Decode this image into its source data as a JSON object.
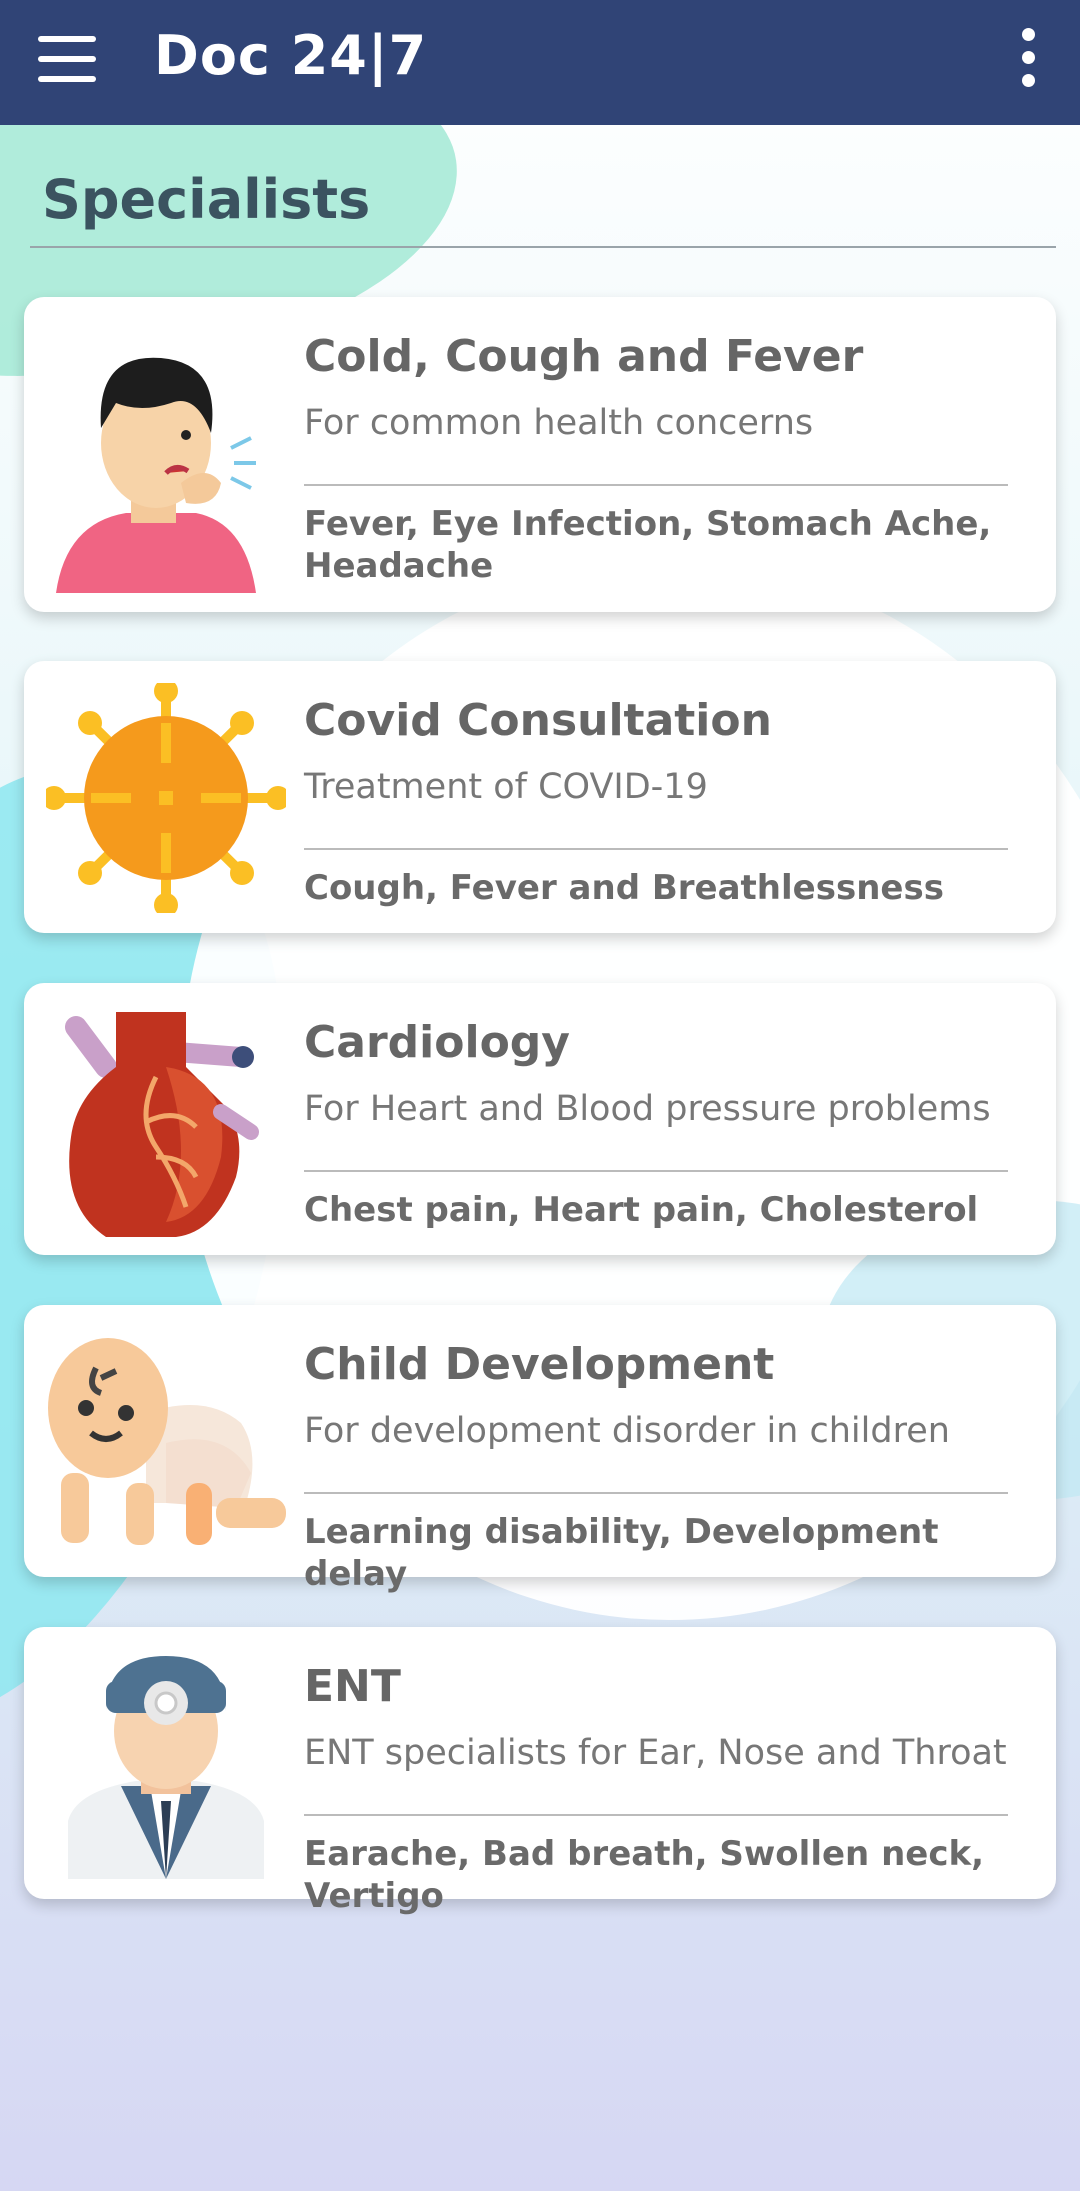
{
  "app": {
    "title": "Doc 24|7",
    "menu_icon": "hamburger-menu-icon",
    "more_icon": "more-vertical-icon",
    "bar_color": "#304476"
  },
  "section": {
    "title": "Specialists"
  },
  "specialists": [
    {
      "title": "Cold, Cough and Fever",
      "subtitle": "For common health concerns",
      "tags": "Fever, Eye Infection, Stomach Ache, Headache",
      "icon": "coughing-person-icon"
    },
    {
      "title": "Covid Consultation",
      "subtitle": "Treatment of COVID-19",
      "tags": "Cough, Fever and Breathlessness",
      "icon": "virus-icon"
    },
    {
      "title": "Cardiology",
      "subtitle": "For Heart and Blood pressure problems",
      "tags": "Chest pain, Heart pain, Cholesterol",
      "icon": "heart-icon"
    },
    {
      "title": "Child Development",
      "subtitle": "For development disorder in children",
      "tags": "Learning disability, Development delay",
      "icon": "crawling-baby-icon"
    },
    {
      "title": "ENT",
      "subtitle": "ENT specialists for Ear, Nose and Throat",
      "tags": "Earache, Bad breath, Swollen neck, Vertigo",
      "icon": "ent-doctor-icon"
    }
  ]
}
